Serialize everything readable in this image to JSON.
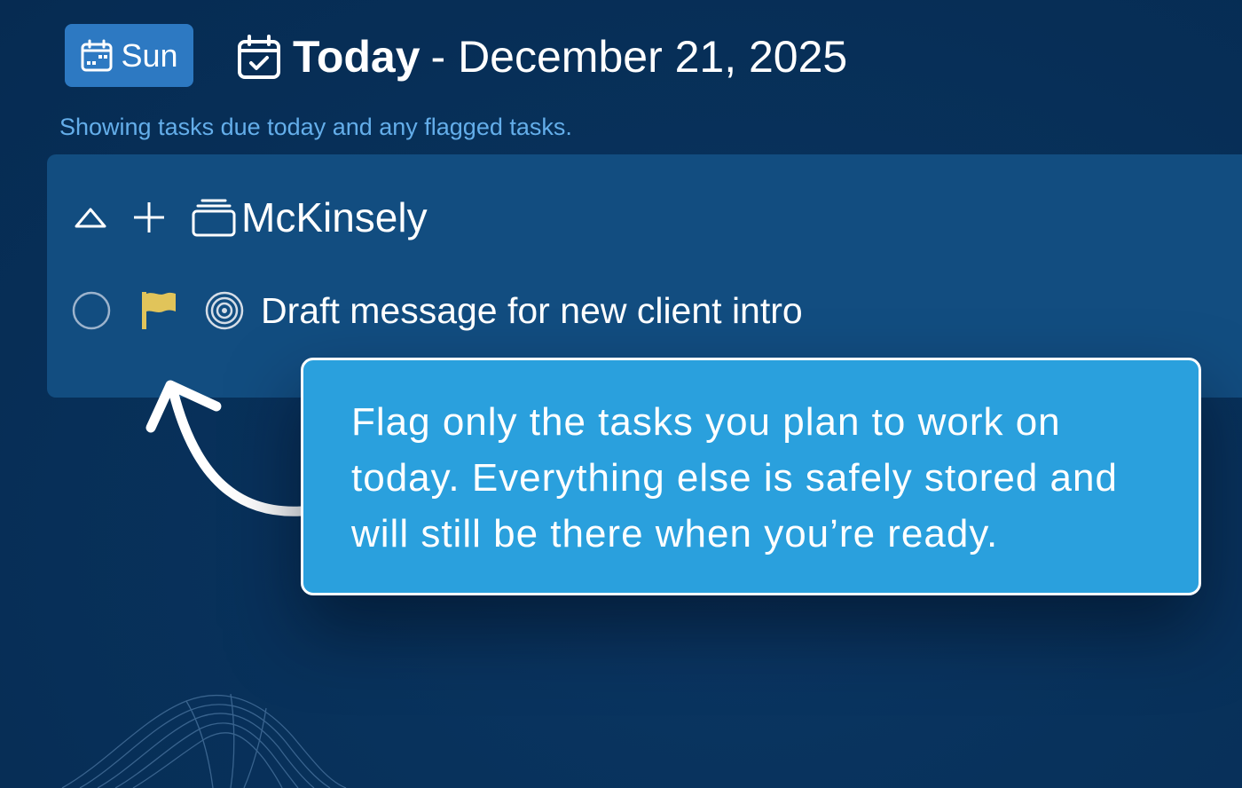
{
  "header": {
    "day_button_label": "Sun",
    "title_bold": "Today",
    "title_rest": "- December 21, 2025",
    "subtitle": "Showing tasks due today and any flagged tasks."
  },
  "project": {
    "name": "McKinsely"
  },
  "tasks": [
    {
      "title": "Draft message for new client intro",
      "flagged": true,
      "flag_color": "#e1c45a"
    }
  ],
  "tooltip": {
    "text": "Flag only the tasks you plan to work on today. Everything else is safely stored and will still be there when you’re ready."
  },
  "colors": {
    "background": "#08325c",
    "panel": "#124d80",
    "day_button": "#2d79c2",
    "subtitle": "#64aeea",
    "tooltip": "#2aa0dd",
    "flag": "#e1c45a"
  },
  "icons": {
    "day_button": "calendar-week-icon",
    "header": "calendar-check-icon",
    "collapse": "chevron-up-icon",
    "add": "plus-icon",
    "project": "stack-icon",
    "task_complete": "circle-icon",
    "task_flag": "flag-icon",
    "task_focus": "target-icon"
  }
}
